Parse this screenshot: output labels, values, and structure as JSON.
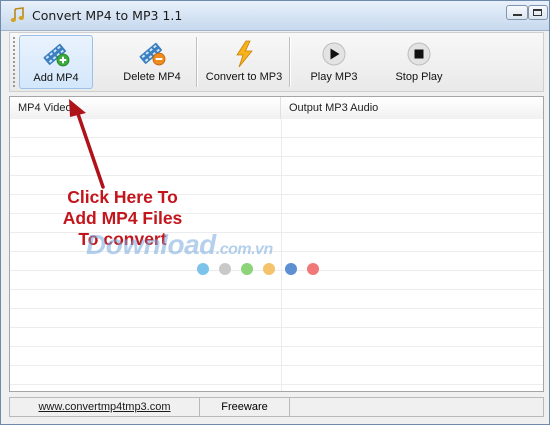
{
  "window": {
    "title": "Convert MP4 to MP3 1.1",
    "app_icon": "music-note-icon"
  },
  "toolbar": {
    "buttons": [
      {
        "label": "Add MP4",
        "icon": "add-film-icon"
      },
      {
        "label": "Delete MP4",
        "icon": "delete-film-icon"
      },
      {
        "label": "Convert to MP3",
        "icon": "lightning-icon"
      },
      {
        "label": "Play MP3",
        "icon": "play-icon"
      },
      {
        "label": "Stop Play",
        "icon": "stop-icon"
      }
    ]
  },
  "list": {
    "columns": [
      "MP4 Video",
      "Output MP3 Audio"
    ],
    "rows": []
  },
  "annotation": {
    "text": "Click Here To\nAdd MP4 Files\nTo convert",
    "color": "#c3151c"
  },
  "watermark": {
    "text": "Download",
    "suffix": ".com.vn",
    "dot_colors": [
      "#7cc3ea",
      "#c9c9c9",
      "#8cd37a",
      "#f5c36b",
      "#5e8fd0",
      "#f07878"
    ]
  },
  "statusbar": {
    "link": "www.convertmp4tmp3.com",
    "license": "Freeware"
  }
}
